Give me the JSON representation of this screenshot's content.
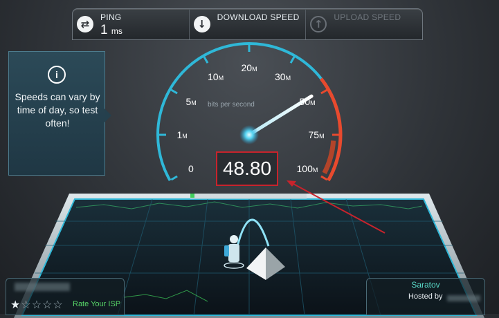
{
  "header": {
    "ping": {
      "label": "PING",
      "value": "1",
      "unit": "ms"
    },
    "download": {
      "label": "DOWNLOAD SPEED"
    },
    "upload": {
      "label": "UPLOAD SPEED"
    }
  },
  "tip": {
    "text": "Speeds can vary by time of day, so test often!"
  },
  "gauge": {
    "units_label": "bits per second",
    "reading": "48.80",
    "needle_value": 48.8,
    "ticks": [
      {
        "num": "0",
        "suf": ""
      },
      {
        "num": "1",
        "suf": "M"
      },
      {
        "num": "5",
        "suf": "M"
      },
      {
        "num": "10",
        "suf": "M"
      },
      {
        "num": "20",
        "suf": "M"
      },
      {
        "num": "30",
        "suf": "M"
      },
      {
        "num": "50",
        "suf": "M"
      },
      {
        "num": "75",
        "suf": "M"
      },
      {
        "num": "100",
        "suf": "M"
      }
    ]
  },
  "isp": {
    "rate_label": "Rate Your ISP",
    "stars_total": 5,
    "stars_filled": 1
  },
  "server": {
    "city": "Saratov",
    "hosted_label": "Hosted by"
  },
  "colors": {
    "accent": "#2fb8d8",
    "danger": "#e84a2e",
    "graph": "#3fcf5a"
  }
}
